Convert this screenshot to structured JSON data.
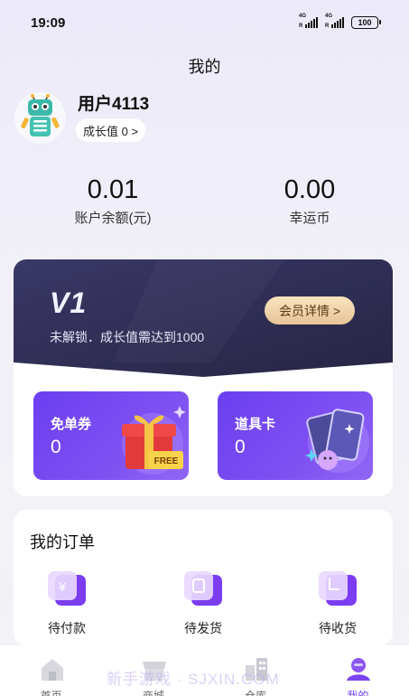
{
  "status_bar": {
    "time": "19:09",
    "network_1": "4G",
    "network_2": "4G",
    "battery": "100"
  },
  "header": {
    "title": "我的"
  },
  "profile": {
    "username": "用户4113",
    "growth_label": "成长值 0 >"
  },
  "stats": [
    {
      "value": "0.01",
      "label": "账户余额(元)"
    },
    {
      "value": "0.00",
      "label": "幸运币"
    }
  ],
  "vip": {
    "level": "V1",
    "description": "未解锁．成长值需达到1000",
    "details_button": "会员详情 >"
  },
  "coupons": [
    {
      "title": "免单券",
      "count": "0",
      "badge": "FREE",
      "icon": "gift-box-icon"
    },
    {
      "title": "道具卡",
      "count": "0",
      "icon": "magic-cards-icon"
    }
  ],
  "orders": {
    "title": "我的订单",
    "items": [
      {
        "label": "待付款",
        "icon": "payment-pending-icon"
      },
      {
        "label": "待发货",
        "icon": "shipping-pending-icon"
      },
      {
        "label": "待收货",
        "icon": "receipt-pending-icon"
      }
    ]
  },
  "tabbar": {
    "items": [
      {
        "label": "首页",
        "icon": "home-icon"
      },
      {
        "label": "商城",
        "icon": "shop-icon"
      },
      {
        "label": "仓库",
        "icon": "warehouse-icon"
      },
      {
        "label": "我的",
        "icon": "profile-icon"
      }
    ],
    "active_index": 3
  },
  "watermark": "新手游戏 · SJXIN.COM",
  "colors": {
    "accent": "#6b3ff0",
    "vip_card": "#2f2d52",
    "gold": "#e7c596"
  }
}
